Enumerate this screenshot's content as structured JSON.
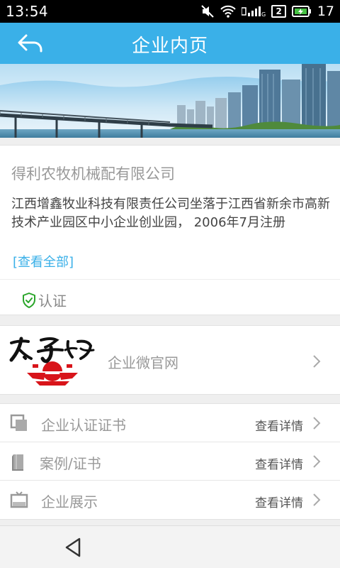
{
  "status_bar": {
    "time": "13:54",
    "sim_slot": "2",
    "battery_level": "17"
  },
  "header": {
    "title": "企业内页",
    "back_icon": "back-arrow-icon"
  },
  "company": {
    "name": "得利农牧机械配有限公司",
    "description": "江西增鑫牧业科技有限责任公司坐落于江西省新余市高新技术产业园区中小企业创业园， 2006年7月注册",
    "view_all": "[查看全部]",
    "certified_label": "认证"
  },
  "microsite": {
    "label": "企业微官网"
  },
  "menu": [
    {
      "label": "企业认证证书",
      "detail": "查看详情",
      "icon": "certificate-icon"
    },
    {
      "label": "案例/证书",
      "detail": "查看详情",
      "icon": "book-icon"
    },
    {
      "label": "企业展示",
      "detail": "查看详情",
      "icon": "display-icon"
    }
  ],
  "colors": {
    "accent": "#3ab0e8",
    "certified": "#2aa52a",
    "logo_red": "#d8141a"
  }
}
